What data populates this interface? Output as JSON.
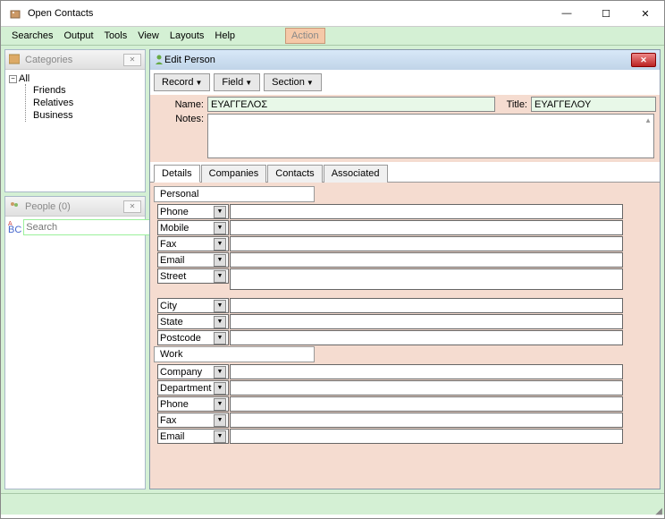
{
  "window": {
    "title": "Open Contacts",
    "min": "—",
    "max": "☐",
    "close": "✕"
  },
  "menu": {
    "items": [
      "Searches",
      "Output",
      "Tools",
      "View",
      "Layouts",
      "Help"
    ],
    "action": "Action"
  },
  "categories": {
    "title": "Categories",
    "root": "All",
    "items": [
      "Friends",
      "Relatives",
      "Business"
    ]
  },
  "people": {
    "title": "People  (0)",
    "placeholder": "Search",
    "abc": "A\nBC"
  },
  "edit": {
    "title": "Edit Person",
    "toolbar": [
      "Record",
      "Field",
      "Section"
    ],
    "name_label": "Name:",
    "name_value": "ΕΥΑΓΓΕΛΟΣ",
    "title_label": "Title:",
    "title_value": "ΕΥΑΓΓΕΛΟΥ",
    "notes_label": "Notes:"
  },
  "tabs": [
    "Details",
    "Companies",
    "Contacts",
    "Associated"
  ],
  "sections": [
    {
      "label": "Personal",
      "fields": [
        "Phone",
        "Mobile",
        "Fax",
        "Email",
        "Street"
      ],
      "multi_last": true
    },
    {
      "label": "Work",
      "fields": [
        "Company",
        "Department",
        "Phone",
        "Fax",
        "Email"
      ],
      "extra": [
        "City",
        "State",
        "Postcode"
      ]
    }
  ]
}
